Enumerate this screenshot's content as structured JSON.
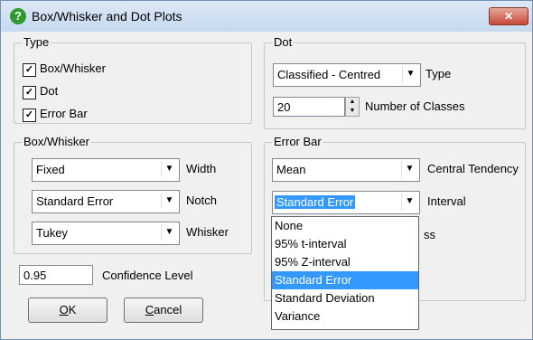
{
  "window": {
    "title": "Box/Whisker and Dot Plots",
    "title_icon": "help-question-icon",
    "close_label": "✕"
  },
  "type_group": {
    "label": "Type",
    "items": [
      {
        "label": "Box/Whisker",
        "checked": true
      },
      {
        "label": "Dot",
        "checked": true
      },
      {
        "label": "Error Bar",
        "checked": true
      }
    ]
  },
  "dot_group": {
    "label": "Dot",
    "type_combo": {
      "value": "Classified - Centred",
      "label": "Type"
    },
    "classes": {
      "value": "20",
      "label": "Number of Classes"
    }
  },
  "box_whisker_group": {
    "label": "Box/Whisker",
    "width_combo": {
      "value": "Fixed",
      "label": "Width"
    },
    "notch_combo": {
      "value": "Standard Error",
      "label": "Notch"
    },
    "whisker_combo": {
      "value": "Tukey",
      "label": "Whisker"
    }
  },
  "error_bar_group": {
    "label": "Error Bar",
    "central_combo": {
      "value": "Mean",
      "label": "Central Tendency"
    },
    "interval_combo": {
      "value": "Standard Error",
      "label": "Interval"
    },
    "hidden_label_tail": "ss"
  },
  "confidence": {
    "value": "0.95",
    "label": "Confidence Level"
  },
  "buttons": {
    "ok": "OK",
    "ok_mnemonic": "O",
    "ok_rest": "K",
    "cancel_mnemonic": "C",
    "cancel_rest": "ancel"
  },
  "interval_dropdown": {
    "options": [
      "None",
      "95% t-interval",
      "95% Z-interval",
      "Standard Error",
      "Standard Deviation",
      "Variance"
    ],
    "selected": "Standard Error"
  },
  "colors": {
    "selection": "#3399ff",
    "title_gradient": "#c6d9ef",
    "close": "#c8493a"
  }
}
